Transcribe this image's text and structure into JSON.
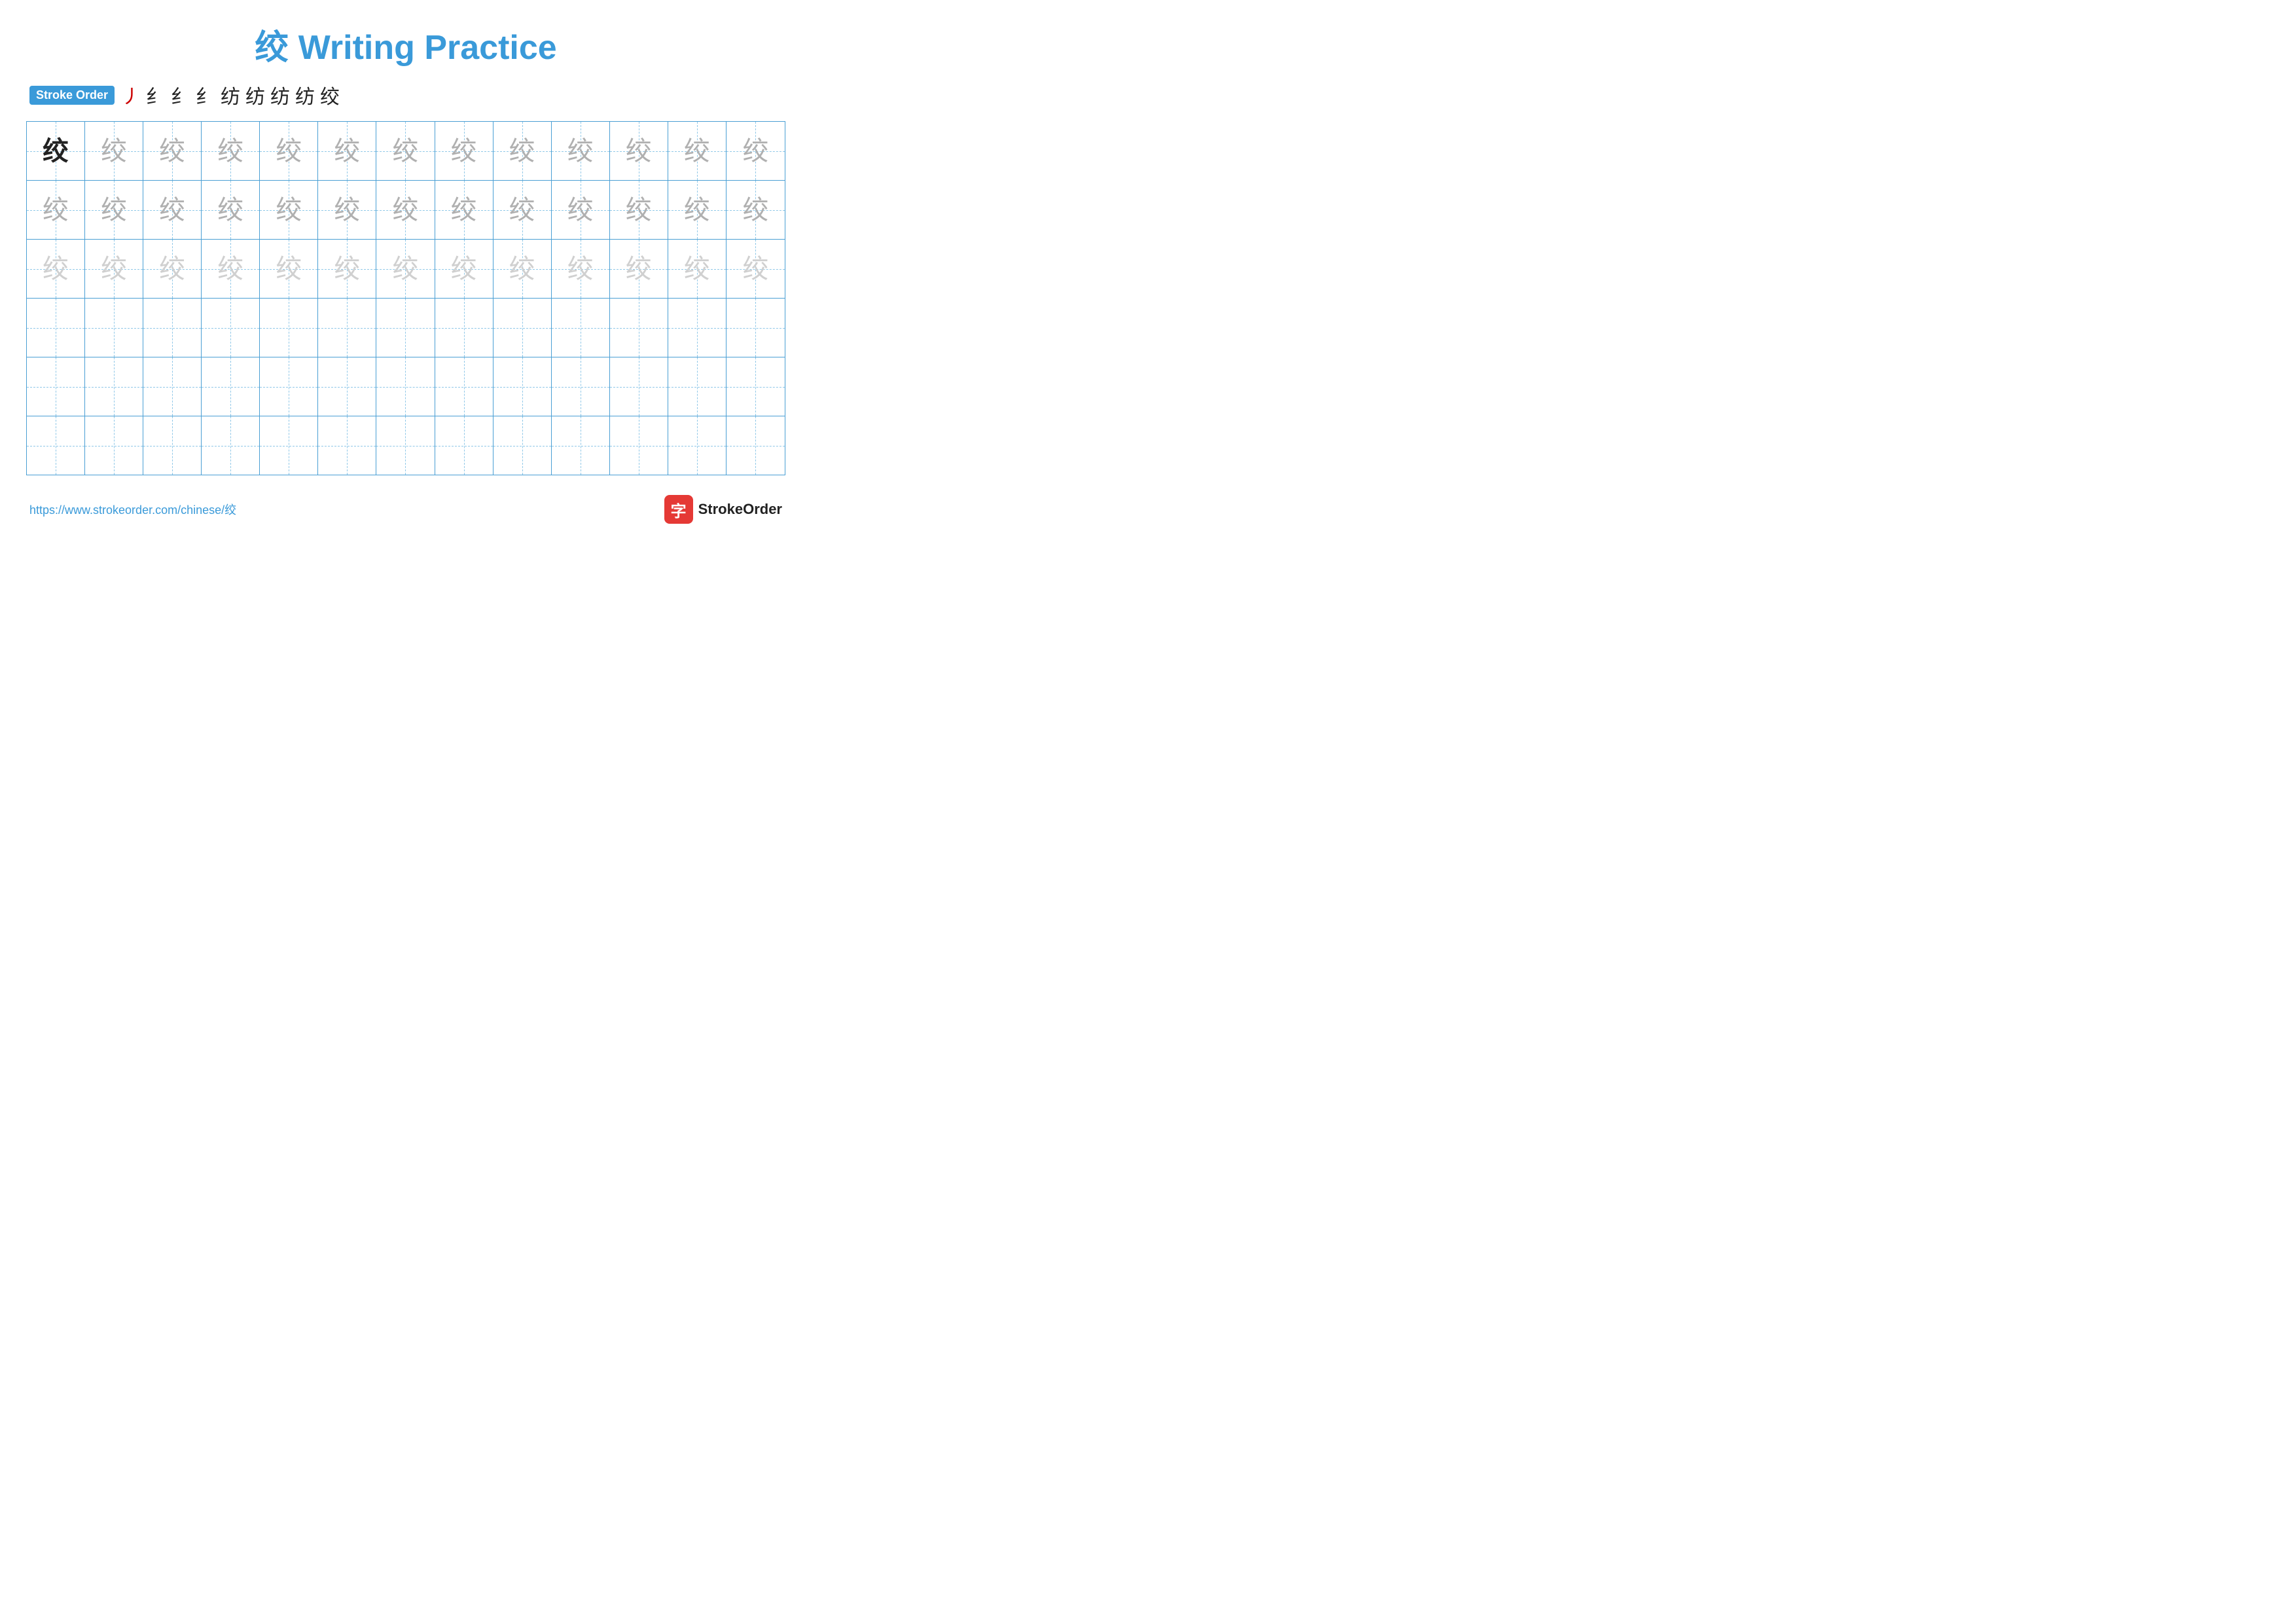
{
  "title": {
    "char": "绞",
    "text": " Writing Practice",
    "color": "#3a9ad9"
  },
  "stroke_order": {
    "badge_label": "Stroke Order",
    "strokes": [
      "㇓",
      "纟",
      "纟",
      "纟",
      "纺",
      "纺",
      "纺",
      "纺",
      "绞"
    ]
  },
  "grid": {
    "rows": 6,
    "cols": 13,
    "character": "绞",
    "row_types": [
      "solid-faded",
      "medium",
      "light",
      "empty",
      "empty",
      "empty"
    ]
  },
  "footer": {
    "url": "https://www.strokeorder.com/chinese/绞",
    "brand": "StrokeOrder",
    "brand_icon": "字"
  }
}
